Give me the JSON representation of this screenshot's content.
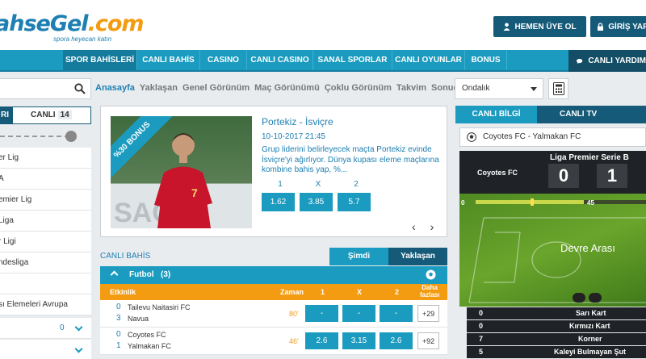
{
  "header": {
    "logo_main": "ahseGel",
    "logo_accent": ".com",
    "tagline": "spora heyecan katın",
    "register_label": "HEMEN ÜYE OL",
    "login_label": "GİRİŞ YAP"
  },
  "nav": {
    "items": [
      "SPOR BAHİSLERİ",
      "CANLI BAHİS",
      "CASINO",
      "CANLI CASINO",
      "SANAL SPORLAR",
      "CANLI OYUNLAR",
      "BONUS"
    ],
    "live_help": "CANLI YARDIM"
  },
  "subnav": [
    "Anasayfa",
    "Yaklaşan",
    "Genel Görünüm",
    "Maç Görünümü",
    "Çoklu Görünüm",
    "Takvim",
    "Sonuçlar"
  ],
  "odds_format": "Ondalık",
  "left": {
    "tab1": "RI",
    "tab2": "CANLI",
    "tab2_count": "14",
    "leagues": [
      "er Lig",
      "A",
      "emier Lig",
      "Liga",
      "r Ligi",
      "ndesliga",
      "",
      "sı Elemeleri Avrupa"
    ],
    "row_count": "0"
  },
  "promo": {
    "bonus_text": "%30 BONUS",
    "banner_text": "SAGR",
    "jersey": "7",
    "title": "Portekiz - İsviçre",
    "date": "10-10-2017 21:45",
    "text": "Grup liderini belirleyecek maçta Portekiz evinde İsviçre'yi ağırlıyor. Dünya kupası eleme maçlarına kombine bahis yap, %...",
    "labels": [
      "1",
      "X",
      "2"
    ],
    "odds": [
      "1.62",
      "3.85",
      "5.7"
    ]
  },
  "live": {
    "title": "CANLI BAHİS",
    "tab_now": "Şimdi",
    "tab_upcoming": "Yaklaşan",
    "sport": "Futbol",
    "sport_count": "(3)",
    "col_event": "Etkinlik",
    "col_time": "Zaman",
    "col_1": "1",
    "col_x": "X",
    "col_2": "2",
    "col_more_1": "Daha",
    "col_more_2": "fazlası",
    "matches": [
      {
        "s1": "0",
        "t1": "Tailevu Naitasiri FC",
        "s2": "3",
        "t2": "Navua",
        "time": "80'",
        "o1": "-",
        "ox": "-",
        "o2": "-",
        "more": "+29"
      },
      {
        "s1": "0",
        "t1": "Coyotes FC",
        "s2": "1",
        "t2": "Yalmakan FC",
        "time": "46'",
        "o1": "2.6",
        "ox": "3.15",
        "o2": "2.6",
        "more": "+92"
      }
    ]
  },
  "right": {
    "tab_info": "CANLI BİLGİ",
    "tab_tv": "CANLI TV",
    "match": "Coyotes FC - Yalmakan FC",
    "league": "Liga Premier Serie B",
    "home": "Coyotes FC",
    "score_home": "0",
    "score_away": "1",
    "minute": "45",
    "status": "Devre Arası",
    "stats": [
      {
        "v": "0",
        "l": "Sarı Kart"
      },
      {
        "v": "0",
        "l": "Kırmızı Kart"
      },
      {
        "v": "7",
        "l": "Korner"
      },
      {
        "v": "5",
        "l": "Kaleyi Bulmayan Şut"
      }
    ]
  }
}
